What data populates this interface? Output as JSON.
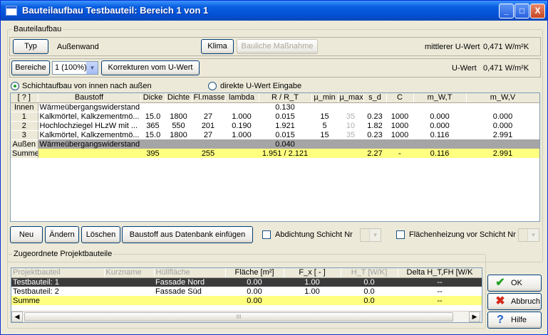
{
  "window": {
    "title": "Bauteilaufbau Testbauteil: Bereich 1 von 1",
    "minimize": "_",
    "maximize": "□",
    "close": "X"
  },
  "bauteilaufbau": {
    "legend": "Bauteilaufbau",
    "typ_button": "Typ",
    "typ_value": "Außenwand",
    "klima_button": "Klima",
    "bauliche_button": "Bauliche Maßnahme",
    "mittlerer_label": "mittlerer U-Wert",
    "mittlerer_value": "0,471  W/m²K",
    "bereiche_button": "Bereiche",
    "bereiche_select": "1 (100%)",
    "korrekturen_button": "Korrekturen vom U-Wert",
    "uwert_label": "U-Wert",
    "uwert_value": "0,471  W/m²K"
  },
  "mode": {
    "radio_schicht": "Schichtaufbau von innen nach außen",
    "radio_direkt": "direkte U-Wert Eingabe"
  },
  "layers": {
    "headers": [
      "[ ? ]",
      "Baustoff",
      "Dicke",
      "Dichte",
      "Fl.masse",
      "lambda",
      "R / R_T",
      "µ_min",
      "µ_max",
      "s_d",
      "C",
      "m_W,T",
      "m_W,V"
    ],
    "rows": [
      {
        "head": "Innen",
        "cells": [
          "Wärmeübergangswiderstand",
          "",
          "",
          "",
          "",
          "0.130",
          "",
          "",
          "",
          "",
          "",
          ""
        ],
        "style": "normal"
      },
      {
        "head": "1",
        "cells": [
          "Kalkmörtel, Kalkzementmö...",
          "15.0",
          "1800",
          "27",
          "1.000",
          "0.015",
          "15",
          "35",
          "0.23",
          "1000",
          "0.000",
          "0.000"
        ],
        "style": "normal"
      },
      {
        "head": "2",
        "cells": [
          "Hochlochziegel HLzW mit ...",
          "365",
          "550",
          "201",
          "0.190",
          "1.921",
          "5",
          "10",
          "1.82",
          "1000",
          "0.000",
          "0.000"
        ],
        "style": "normal"
      },
      {
        "head": "3",
        "cells": [
          "Kalkmörtel, Kalkzementmö...",
          "15.0",
          "1800",
          "27",
          "1.000",
          "0.015",
          "15",
          "35",
          "0.23",
          "1000",
          "0.116",
          "2.991"
        ],
        "style": "normal"
      },
      {
        "head": "Außen",
        "cells": [
          "Wärmeübergangswiderstand",
          "",
          "",
          "",
          "",
          "0.040",
          "",
          "",
          "",
          "",
          "",
          ""
        ],
        "style": "gray"
      },
      {
        "head": "Summe",
        "cells": [
          "",
          "395",
          "",
          "255",
          "",
          "1.951 / 2.121",
          "",
          "",
          "2.27",
          "-",
          "0.116",
          "2.991"
        ],
        "style": "yellow"
      }
    ]
  },
  "layer_actions": {
    "neu": "Neu",
    "aendern": "Ändern",
    "loeschen": "Löschen",
    "baustoff": "Baustoff aus Datenbank einfügen",
    "abdichtung": "Abdichtung Schicht Nr",
    "flaechenheizung": "Flächenheizung vor Schicht Nr"
  },
  "projekt": {
    "legend": "Zugeordnete Projektbauteile",
    "headers": [
      "Projektbauteil",
      "Kurzname",
      "Hüllfläche",
      "Fläche [m²]",
      "F_x [ - ]",
      "H_T [W/K]",
      "Delta H_T,FH [W/K"
    ],
    "rows": [
      {
        "cells": [
          "Testbauteil: 1",
          "",
          "Fassade Nord",
          "0.00",
          "1.00",
          "0.0",
          "--"
        ],
        "style": "dark"
      },
      {
        "cells": [
          "Testbauteil: 2",
          "",
          "Fassade Süd",
          "0.00",
          "1.00",
          "0.0",
          "--"
        ],
        "style": "normal"
      },
      {
        "cells": [
          "Summe",
          "",
          "",
          "0.00",
          "",
          "0.0",
          "--"
        ],
        "style": "yellow"
      }
    ],
    "scroll_thumb": "III"
  },
  "buttons": {
    "ok": "OK",
    "abbruch": "Abbruch",
    "hilfe": "Hilfe"
  },
  "colors": {
    "titlebar": "#0351d6",
    "summe_row": "#ffff80",
    "aussen_row": "#a5a5a5",
    "selected_row": "#3b3b3b"
  }
}
